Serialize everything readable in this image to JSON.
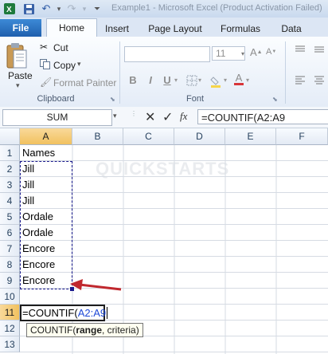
{
  "title_bar": {
    "title": "Example1 - Microsoft Excel (Product Activation Failed)"
  },
  "tabs": [
    "File",
    "Home",
    "Insert",
    "Page Layout",
    "Formulas",
    "Data"
  ],
  "ribbon": {
    "clipboard": {
      "paste": "Paste",
      "cut": "Cut",
      "copy": "Copy",
      "format_painter": "Format Painter",
      "label": "Clipboard"
    },
    "font": {
      "size": "11",
      "label": "Font",
      "bold": "B",
      "italic": "I",
      "underline": "U"
    }
  },
  "formula_bar": {
    "name_box": "SUM",
    "fx": "fx",
    "formula": "=COUNTIF(A2:A9"
  },
  "grid": {
    "columns": [
      "A",
      "B",
      "C",
      "D",
      "E",
      "F"
    ],
    "rows": [
      "1",
      "2",
      "3",
      "4",
      "5",
      "6",
      "7",
      "8",
      "9",
      "10",
      "11",
      "12",
      "13"
    ],
    "cells": [
      {
        "row": 1,
        "value": "Names"
      },
      {
        "row": 2,
        "value": "Jill"
      },
      {
        "row": 3,
        "value": "Jill"
      },
      {
        "row": 4,
        "value": "Jill"
      },
      {
        "row": 5,
        "value": "Ordale"
      },
      {
        "row": 6,
        "value": "Ordale"
      },
      {
        "row": 7,
        "value": "Encore"
      },
      {
        "row": 8,
        "value": "Encore"
      },
      {
        "row": 9,
        "value": "Encore"
      }
    ],
    "editing": {
      "prefix": "=COUNTIF(",
      "range_ref": "A2:A9"
    },
    "tooltip": {
      "func": "COUNTIF(",
      "bold_arg": "range",
      "rest": ", criteria)"
    },
    "watermark": "QUICKSTARTS"
  },
  "colors": {
    "range_ref": "#1f49d6",
    "arrow": "#c0282e",
    "marquee": "#1a1a8c"
  }
}
